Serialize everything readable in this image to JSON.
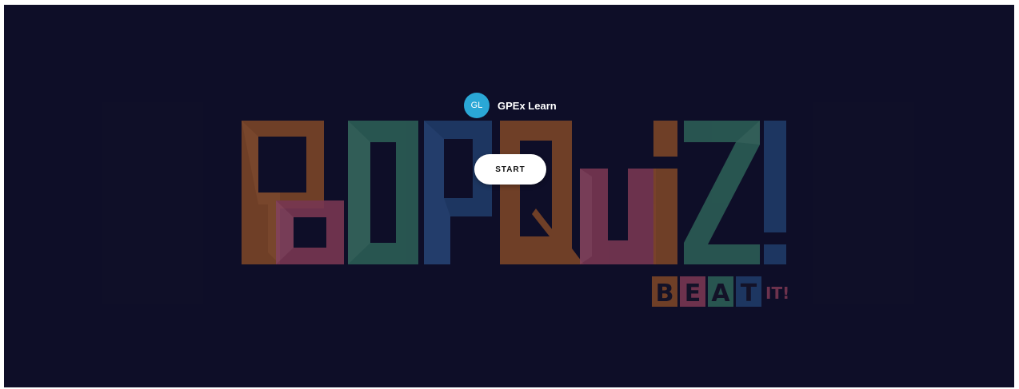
{
  "colors": {
    "stage_bg": "#12112e",
    "avatar_bg": "#2aa7d6",
    "logo_orange": "#b7652d",
    "logo_pink": "#b3506e",
    "logo_green": "#3f8a73",
    "logo_blue": "#2c5690"
  },
  "host": {
    "initials": "GL",
    "name": "GPEx Learn"
  },
  "start_button": {
    "label": "START"
  },
  "logo": {
    "main_text": "POPQUIZ!",
    "tagline_left": "BEAT",
    "tagline_right": "IT!"
  }
}
